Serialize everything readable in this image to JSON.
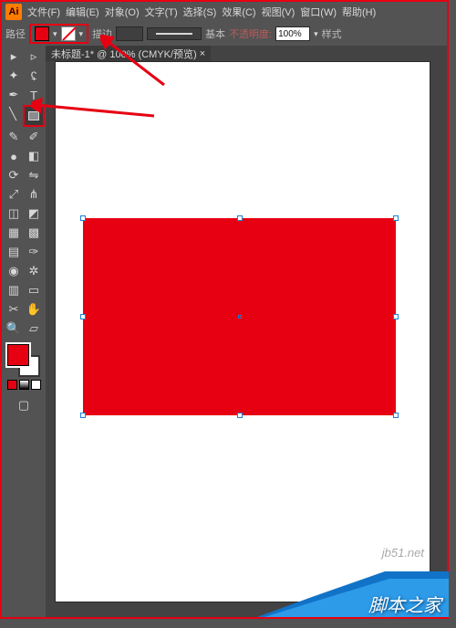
{
  "menu": {
    "items": [
      "文件(F)",
      "编辑(E)",
      "对象(O)",
      "文字(T)",
      "选择(S)",
      "效果(C)",
      "视图(V)",
      "窗口(W)",
      "帮助(H)"
    ]
  },
  "options": {
    "path_label": "路径",
    "fill_color": "#e60012",
    "stroke_state": "none",
    "stroke_label": "描边",
    "stroke_weight": "",
    "brush_label": "基本",
    "opacity_label": "不透明度:",
    "opacity_value": "100%",
    "style_label": "样式"
  },
  "tab": {
    "title": "未标题-1* @ 100% (CMYK/预览)"
  },
  "tools": {
    "fill_color": "#e60012",
    "stroke_color": "#ffffff"
  },
  "shape": {
    "fill": "#e60012"
  },
  "watermark": "jb51.net",
  "caption": "脚本之家"
}
